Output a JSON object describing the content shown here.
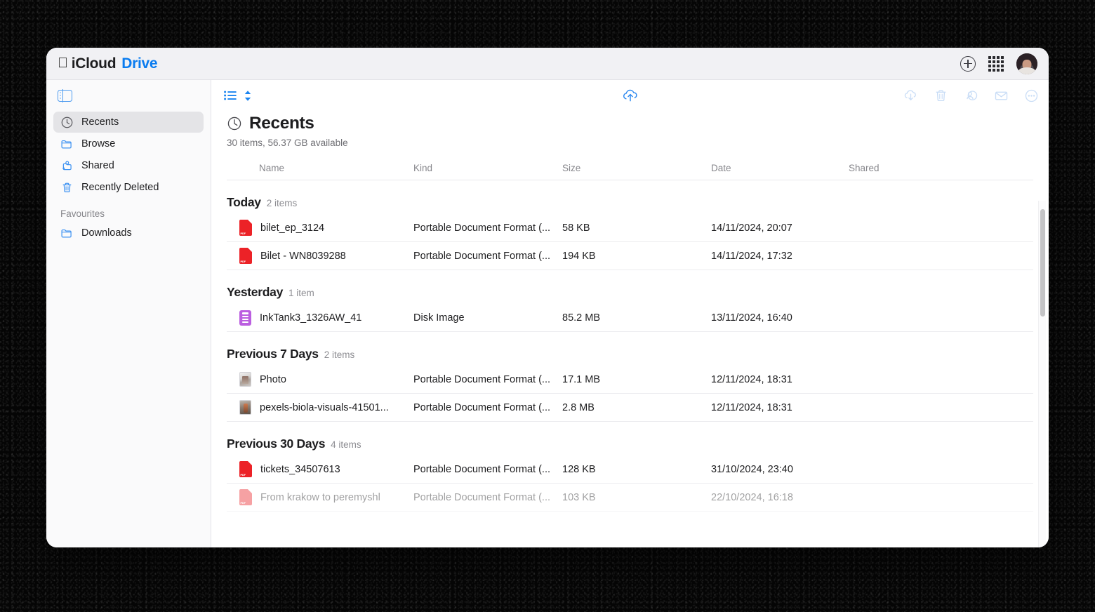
{
  "window": {
    "brand_apple_logo": "",
    "brand_icloud": "iCloud",
    "brand_drive": "Drive",
    "accent_blue": "#0a7cf0",
    "header_bg": "#f1f1f4"
  },
  "titlebar": {
    "add_label": "plus-circle",
    "apps_label": "app-grid",
    "avatar_label": "account-avatar"
  },
  "sidebar": {
    "toggle_label": "sidebar-toggle",
    "items": [
      {
        "label": "Recents",
        "icon": "clock-icon",
        "active": true
      },
      {
        "label": "Browse",
        "icon": "folder-icon",
        "active": false
      },
      {
        "label": "Shared",
        "icon": "shared-folder-icon",
        "active": false
      },
      {
        "label": "Recently Deleted",
        "icon": "trash-icon",
        "active": false
      }
    ],
    "favourites_label": "Favourites",
    "favourites": [
      {
        "label": "Downloads",
        "icon": "folder-icon"
      }
    ]
  },
  "toolbar": {
    "view_list_label": "list-view",
    "sort_label": "sort",
    "upload_label": "upload-to-icloud",
    "actions": [
      {
        "name": "download-icon",
        "label": "Download",
        "enabled": false
      },
      {
        "name": "trash-icon",
        "label": "Delete",
        "enabled": false
      },
      {
        "name": "share-person-icon",
        "label": "Share",
        "enabled": false
      },
      {
        "name": "mail-icon",
        "label": "Email",
        "enabled": false
      },
      {
        "name": "more-icon",
        "label": "More",
        "enabled": false
      }
    ]
  },
  "main": {
    "title": "Recents",
    "title_icon": "clock-icon",
    "subtitle": "30 items, 56.37 GB available",
    "columns": {
      "name": "Name",
      "kind": "Kind",
      "size": "Size",
      "date": "Date",
      "shared": "Shared"
    },
    "groups": [
      {
        "title": "Today",
        "count": "2 items",
        "files": [
          {
            "name": "bilet_ep_3124",
            "icon": "pdf-icon",
            "kind": "Portable Document Format (...",
            "size": "58 KB",
            "date": "14/11/2024, 20:07",
            "shared": "",
            "dimmed": false
          },
          {
            "name": "Bilet - WN8039288",
            "icon": "pdf-icon",
            "kind": "Portable Document Format (...",
            "size": "194 KB",
            "date": "14/11/2024, 17:32",
            "shared": "",
            "dimmed": false
          }
        ]
      },
      {
        "title": "Yesterday",
        "count": "1 item",
        "files": [
          {
            "name": "InkTank3_1326AW_41",
            "icon": "disk-image-icon",
            "kind": "Disk Image",
            "size": "85.2 MB",
            "date": "13/11/2024, 16:40",
            "shared": "",
            "dimmed": false
          }
        ]
      },
      {
        "title": "Previous 7 Days",
        "count": "2 items",
        "files": [
          {
            "name": "Photo",
            "icon": "thumbnail-a-icon",
            "kind": "Portable Document Format (...",
            "size": "17.1 MB",
            "date": "12/11/2024, 18:31",
            "shared": "",
            "dimmed": false
          },
          {
            "name": "pexels-biola-visuals-41501...",
            "icon": "thumbnail-b-icon",
            "kind": "Portable Document Format (...",
            "size": "2.8 MB",
            "date": "12/11/2024, 18:31",
            "shared": "",
            "dimmed": false
          }
        ]
      },
      {
        "title": "Previous 30 Days",
        "count": "4 items",
        "files": [
          {
            "name": "tickets_34507613",
            "icon": "pdf-icon",
            "kind": "Portable Document Format (...",
            "size": "128 KB",
            "date": "31/10/2024, 23:40",
            "shared": "",
            "dimmed": false
          },
          {
            "name": "From krakow to peremyshl",
            "icon": "pdf-icon",
            "kind": "Portable Document Format (...",
            "size": "103 KB",
            "date": "22/10/2024, 16:18",
            "shared": "",
            "dimmed": true
          }
        ]
      }
    ]
  },
  "pdf_badge": "PDF"
}
